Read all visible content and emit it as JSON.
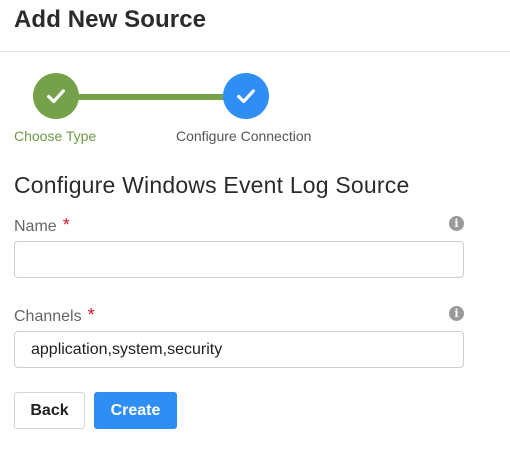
{
  "page": {
    "title": "Add New Source"
  },
  "stepper": {
    "steps": [
      {
        "label": "Choose Type",
        "state": "complete"
      },
      {
        "label": "Configure Connection",
        "state": "active"
      }
    ],
    "colors": {
      "complete": "#75a14a",
      "active": "#2f8ef4"
    }
  },
  "form": {
    "title": "Configure Windows Event Log Source",
    "required_marker": "*",
    "info_glyph": "i",
    "fields": [
      {
        "label": "Name",
        "value": "",
        "placeholder": "",
        "required": true
      },
      {
        "label": "Channels",
        "value": "application,system,security",
        "placeholder": "",
        "required": true
      }
    ]
  },
  "actions": {
    "back_label": "Back",
    "create_label": "Create"
  }
}
